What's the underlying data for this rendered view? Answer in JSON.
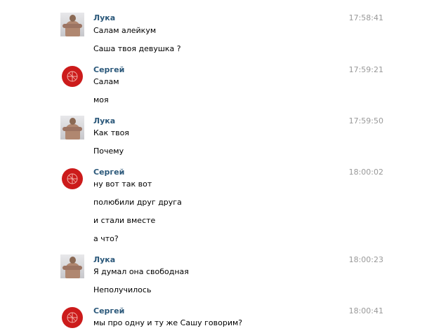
{
  "messages": [
    {
      "author": "Лука",
      "avatar": "photo-avatar",
      "time": "17:58:41",
      "lines": [
        "Салам алейкум",
        "Саша твоя девушка ?"
      ]
    },
    {
      "author": "Сергей",
      "avatar": "red-emblem-avatar",
      "time": "17:59:21",
      "lines": [
        "Салам",
        "моя"
      ]
    },
    {
      "author": "Лука",
      "avatar": "photo-avatar",
      "time": "17:59:50",
      "lines": [
        "Как твоя",
        "Почему"
      ]
    },
    {
      "author": "Сергей",
      "avatar": "red-emblem-avatar",
      "time": "18:00:02",
      "lines": [
        "ну вот так вот",
        "полюбили друг друга",
        "и стали вместе",
        "а что?"
      ]
    },
    {
      "author": "Лука",
      "avatar": "photo-avatar",
      "time": "18:00:23",
      "lines": [
        "Я думал она свободная",
        "Неполучилось"
      ]
    },
    {
      "author": "Сергей",
      "avatar": "red-emblem-avatar",
      "time": "18:00:41",
      "lines": [
        "мы про одну и ту же Сашу говорим?"
      ]
    }
  ],
  "colors": {
    "author_link": "#2b587a",
    "timestamp": "#999999",
    "emblem_red": "#cc1b1b"
  }
}
